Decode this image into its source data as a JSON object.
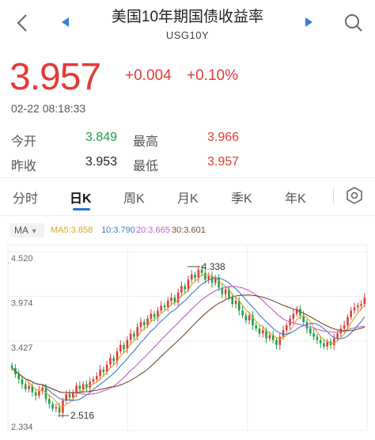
{
  "header": {
    "title": "美国10年期国债收益率",
    "subtitle": "USG10Y"
  },
  "quote": {
    "price": "3.957",
    "change": "+0.004",
    "change_pct": "+0.10%",
    "timestamp": "02-22 08:18:33"
  },
  "stats": {
    "open_label": "今开",
    "open": "3.849",
    "high_label": "最高",
    "high": "3.966",
    "prev_label": "昨收",
    "prev": "3.953",
    "low_label": "最低",
    "low": "3.957"
  },
  "tabs": [
    "分时",
    "日K",
    "周K",
    "月K",
    "季K",
    "年K"
  ],
  "active_tab": "日K",
  "indicator": {
    "selector": "MA",
    "ma5": "MA5:3.858",
    "ma10": "10:3.790",
    "ma20": "20:3.665",
    "ma30": "30:3.601"
  },
  "colors": {
    "up": "#e23b36",
    "down": "#1aa34a",
    "ma5": "#e0a21c",
    "ma10": "#3a7bd5",
    "ma20": "#c45bc8",
    "ma30": "#7a4a2a"
  },
  "chart_data": {
    "type": "candlestick",
    "y_ticks": [
      "4.520",
      "3.974",
      "3.427",
      "2.334"
    ],
    "ylim": [
      2.334,
      4.52
    ],
    "annotations": [
      {
        "text": "4.338",
        "value": 4.338
      },
      {
        "text": "2.516",
        "value": 2.516
      }
    ],
    "closes": [
      3.1,
      3.02,
      2.96,
      2.9,
      2.84,
      2.88,
      2.8,
      2.76,
      2.82,
      2.86,
      2.72,
      2.66,
      2.6,
      2.62,
      2.55,
      2.7,
      2.78,
      2.74,
      2.8,
      2.88,
      2.84,
      2.9,
      2.86,
      2.93,
      2.96,
      3.0,
      3.08,
      3.05,
      3.14,
      3.22,
      3.18,
      3.3,
      3.38,
      3.33,
      3.44,
      3.52,
      3.48,
      3.6,
      3.66,
      3.62,
      3.7,
      3.76,
      3.72,
      3.8,
      3.86,
      3.84,
      3.92,
      3.96,
      3.9,
      4.02,
      4.1,
      4.06,
      4.18,
      4.24,
      4.2,
      4.3,
      4.26,
      4.18,
      4.22,
      4.14,
      4.2,
      4.08,
      4.0,
      4.06,
      3.96,
      3.88,
      3.92,
      3.8,
      3.74,
      3.68,
      3.74,
      3.62,
      3.58,
      3.52,
      3.56,
      3.46,
      3.5,
      3.44,
      3.38,
      3.48,
      3.56,
      3.62,
      3.7,
      3.76,
      3.82,
      3.74,
      3.66,
      3.58,
      3.52,
      3.48,
      3.44,
      3.4,
      3.36,
      3.42,
      3.38,
      3.46,
      3.52,
      3.58,
      3.62,
      3.72,
      3.8,
      3.84,
      3.86,
      3.88,
      3.957
    ]
  }
}
